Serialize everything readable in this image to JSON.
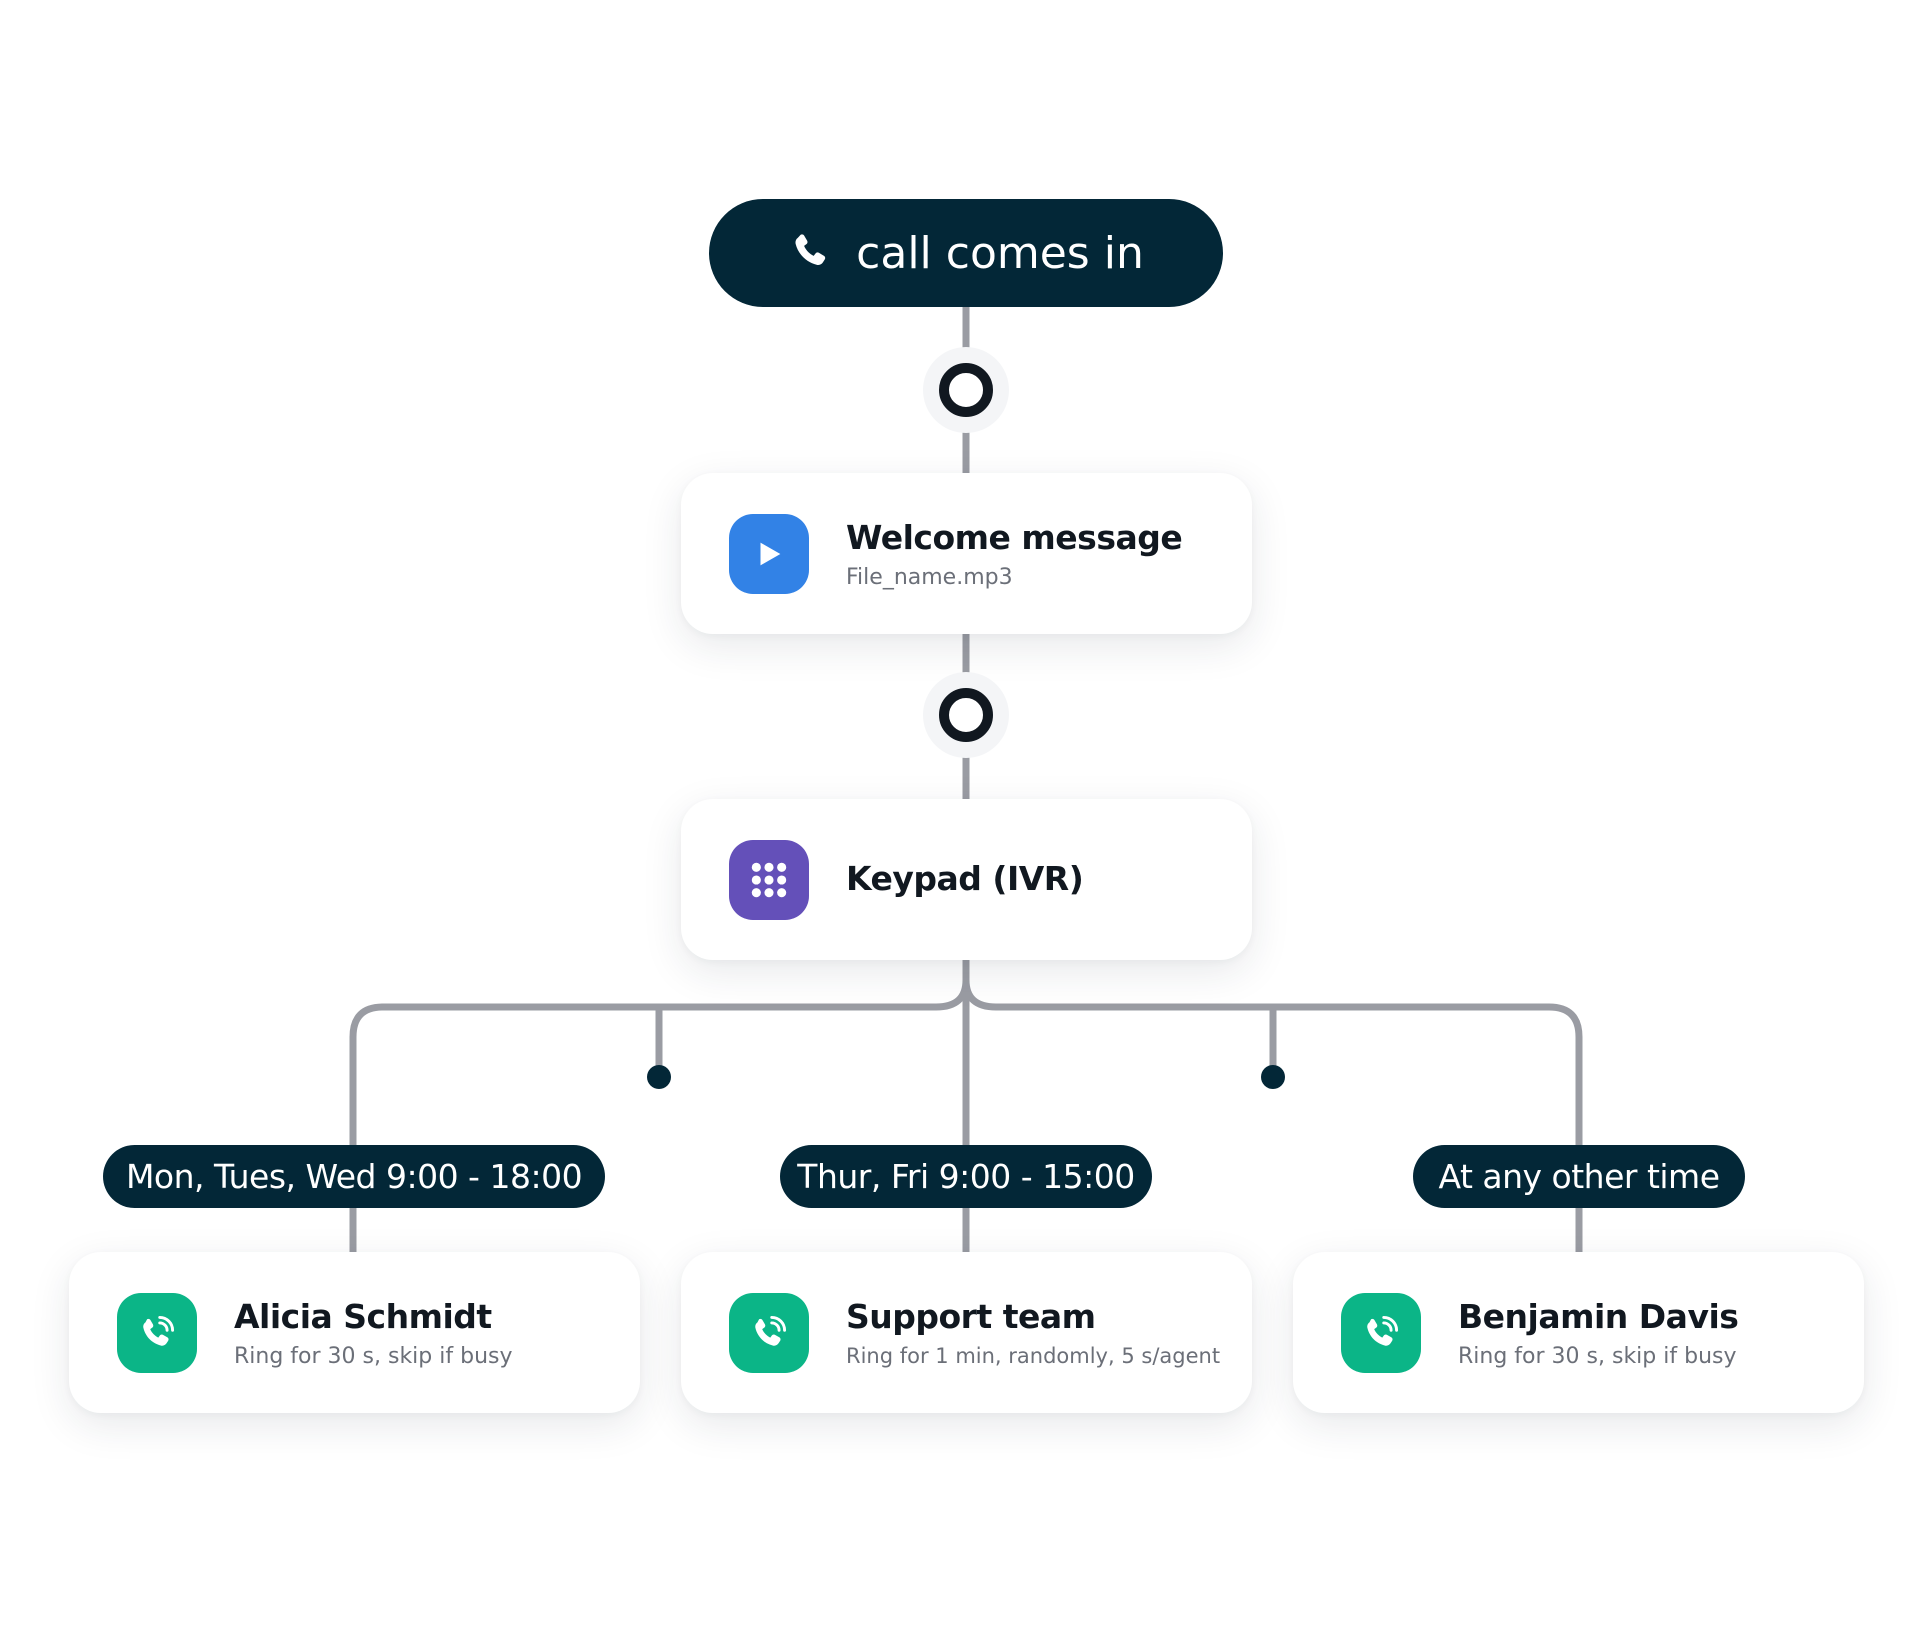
{
  "start": {
    "label": "call comes in",
    "icon": "phone-icon"
  },
  "welcome": {
    "title": "Welcome message",
    "subtitle": "File_name.mp3",
    "icon": "play-icon",
    "color": "#3282E6"
  },
  "keypad": {
    "title": "Keypad (IVR)",
    "icon": "keypad-icon",
    "color": "#6450B9"
  },
  "branches": [
    {
      "label": "Mon, Tues, Wed 9:00 - 18:00",
      "title": "Alicia Schmidt",
      "subtitle": "Ring for 30 s, skip if busy",
      "icon": "phone-ringing-icon"
    },
    {
      "label": "Thur, Fri 9:00 - 15:00",
      "title": "Support team",
      "subtitle": "Ring for 1 min, randomly, 5 s/agent",
      "icon": "phone-ringing-icon"
    },
    {
      "label": "At any other time",
      "title": "Benjamin Davis",
      "subtitle": "Ring for 30 s, skip if busy",
      "icon": "phone-ringing-icon"
    }
  ],
  "colors": {
    "dark": "#032737",
    "line": "#9A9CA3",
    "agent": "#0BB587"
  }
}
